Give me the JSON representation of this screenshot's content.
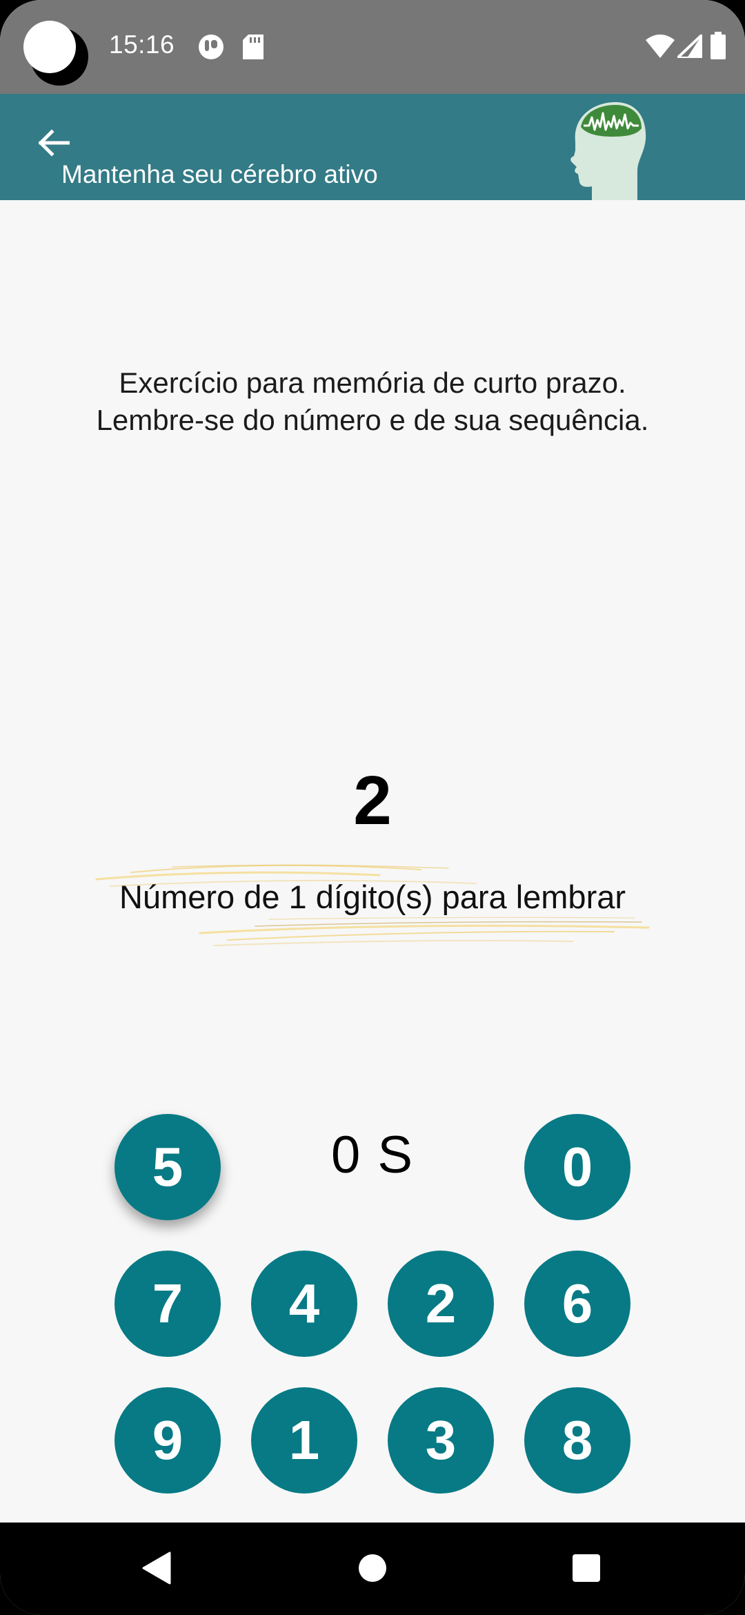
{
  "status_bar": {
    "time": "15:16",
    "icons": [
      "notification-app-icon",
      "sd-card-icon",
      "wifi-icon",
      "cell-signal-icon",
      "battery-icon"
    ]
  },
  "app_bar": {
    "back_icon": "arrow-left-icon",
    "subtitle": "Mantenha seu cérebro ativo",
    "logo": "brain-head-logo",
    "color": "#337b86"
  },
  "content": {
    "instruction_line_1": "Exercício para memória de curto prazo.",
    "instruction_line_2": "Lembre-se do número e de sua sequência.",
    "number": "2",
    "caption": "Número de 1 dígito(s) para lembrar",
    "timer": "0 S"
  },
  "keypad": {
    "color": "#077a85",
    "rows": [
      [
        "5",
        "0"
      ],
      [
        "7",
        "4",
        "2",
        "6"
      ],
      [
        "9",
        "1",
        "3",
        "8"
      ]
    ]
  },
  "nav_bar": {
    "icons": [
      "back-triangle-icon",
      "home-circle-icon",
      "recents-square-icon"
    ]
  }
}
